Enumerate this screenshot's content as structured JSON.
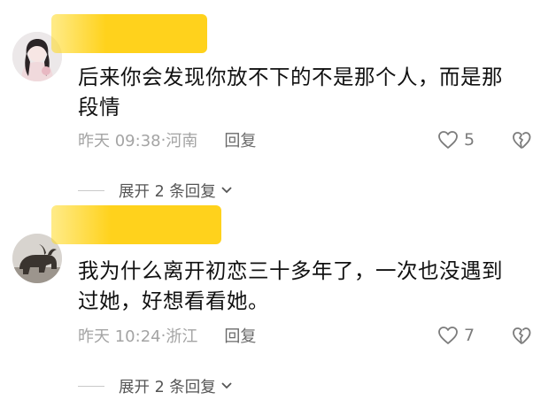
{
  "comments": [
    {
      "text": "后来你会发现你放不下的不是那个人，而是那段情",
      "time": "昨天 09:38",
      "location": "河南",
      "reply_label": "回复",
      "likes": "5",
      "expand_label": "展开 2 条回复",
      "avatar_icon": "girl-avatar-icon",
      "name_highlight_color": "#ffd21c"
    },
    {
      "text": "我为什么离开初恋三十多年了，一次也没遇到过她，好想看看她。",
      "time": "昨天 10:24",
      "location": "浙江",
      "reply_label": "回复",
      "likes": "7",
      "expand_label": "展开 2 条回复",
      "avatar_icon": "bull-statue-avatar-icon",
      "name_highlight_color": "#ffd21c"
    }
  ],
  "separator": "·"
}
